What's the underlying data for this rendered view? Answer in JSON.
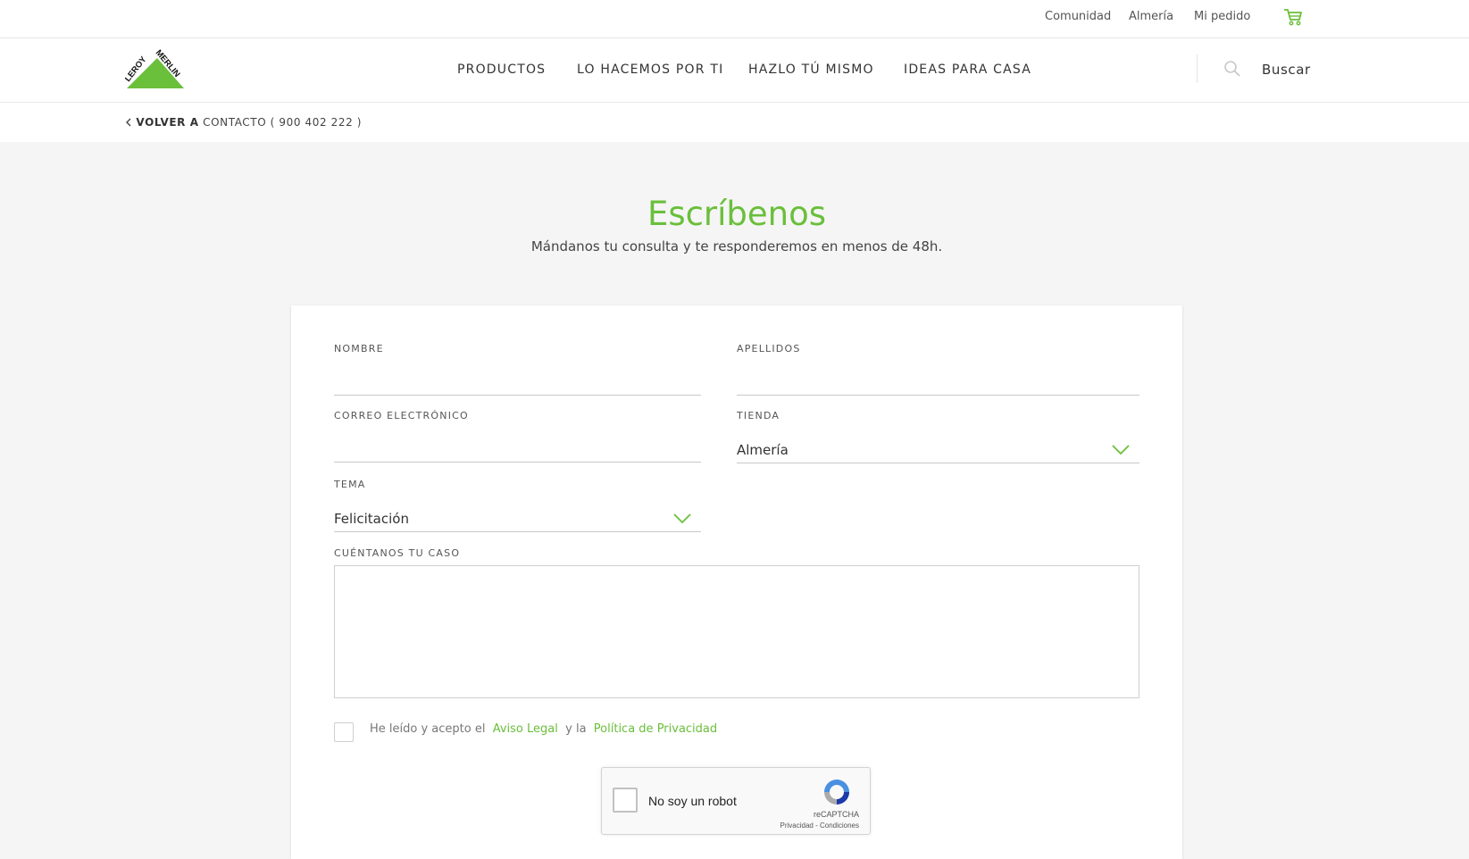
{
  "topbar": {
    "links": [
      "Comunidad",
      "Almería",
      "Mi pedido"
    ],
    "cart_icon": "cart-icon"
  },
  "brand": {
    "logo_text": "LEROY MERLIN",
    "logo_color": "#6abf3b"
  },
  "nav": {
    "items": [
      "PRODUCTOS",
      "LO HACEMOS POR TI",
      "HAZLO TÚ MISMO",
      "IDEAS PARA CASA"
    ],
    "search_label": "Buscar"
  },
  "breadcrumb": {
    "back": "VOLVER A",
    "target": "CONTACTO ( 900 402 222 )"
  },
  "page": {
    "title": "Escríbenos",
    "subtitle": "Mándanos tu consulta y te responderemos en menos de 48h."
  },
  "form": {
    "nombre_label": "NOMBRE",
    "nombre_value": "",
    "apellidos_label": "APELLIDOS",
    "apellidos_value": "",
    "email_label": "CORREO ELECTRÓNICO",
    "email_value": "",
    "tienda_label": "TIENDA",
    "tienda_value": "Almería",
    "tema_label": "TEMA",
    "tema_value": "Felicitación",
    "caso_label": "CUÉNTANOS TU CASO",
    "caso_value": "",
    "legal_prefix": "He leído y acepto el",
    "legal_link1": "Aviso Legal",
    "legal_middle": "y la",
    "legal_link2": "Política de Privacidad",
    "legal_checked": false
  },
  "captcha": {
    "label": "No soy un robot",
    "brand": "reCAPTCHA",
    "links": "Privacidad - Condiciones"
  },
  "colors": {
    "accent": "#6abf3b",
    "background": "#f5f5f5"
  }
}
